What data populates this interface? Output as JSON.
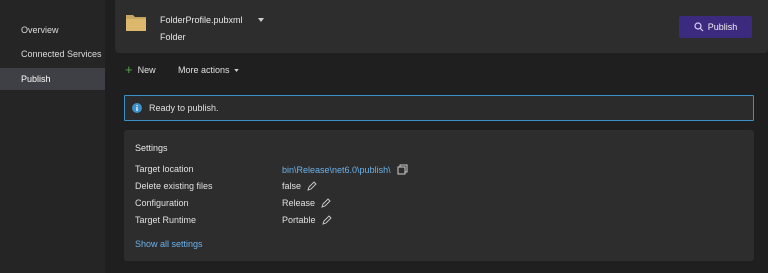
{
  "sidebar": {
    "items": [
      {
        "label": "Overview"
      },
      {
        "label": "Connected Services"
      },
      {
        "label": "Publish"
      }
    ]
  },
  "profile": {
    "name": "FolderProfile.pubxml",
    "type": "Folder",
    "publish_label": "Publish"
  },
  "toolbar": {
    "new_label": "New",
    "more_label": "More actions"
  },
  "info": {
    "message": "Ready to publish."
  },
  "settings": {
    "title": "Settings",
    "rows": [
      {
        "label": "Target location",
        "value": "bin\\Release\\net6.0\\publish\\"
      },
      {
        "label": "Delete existing files",
        "value": "false"
      },
      {
        "label": "Configuration",
        "value": "Release"
      },
      {
        "label": "Target Runtime",
        "value": "Portable"
      }
    ],
    "show_all_label": "Show all settings"
  },
  "colors": {
    "accent": "#3c2a7f",
    "link": "#6cb2eb",
    "info_border": "#3c8fc7",
    "plus": "#57a64a"
  },
  "icons": [
    "folder-icon",
    "caret-down-icon",
    "publish-icon",
    "plus-icon",
    "info-icon",
    "copy-icon",
    "pencil-icon"
  ]
}
